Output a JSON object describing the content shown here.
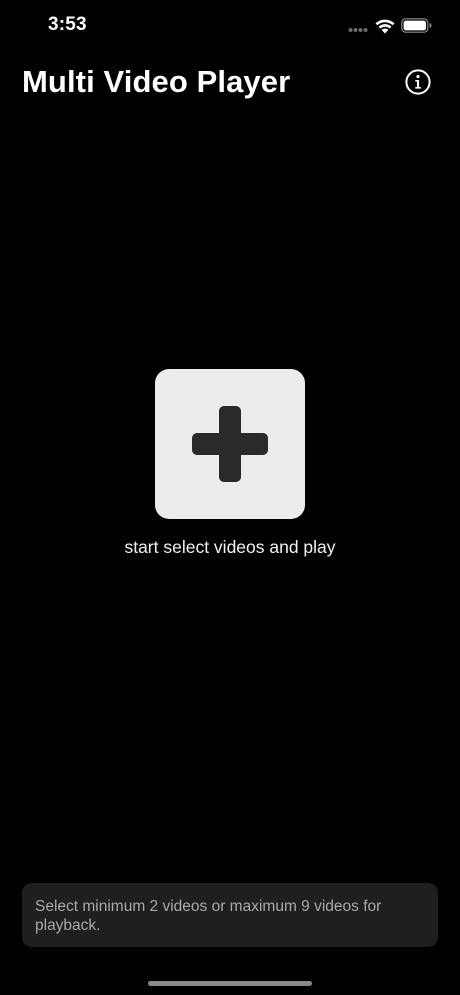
{
  "status_bar": {
    "time": "3:53",
    "icons": [
      "signal-dots-icon",
      "wifi-icon",
      "battery-icon"
    ]
  },
  "nav": {
    "title": "Multi Video Player",
    "info_icon": "info-circle-icon"
  },
  "main": {
    "add_icon": "plus-icon",
    "caption": "start select videos and play"
  },
  "hint": {
    "text": "Select minimum 2 videos or maximum 9 videos for playback."
  },
  "colors": {
    "background": "#000000",
    "add_tile": "#ececec",
    "plus": "#2a2a2a",
    "hint_bg": "#1f1f21",
    "hint_text": "#a8a8ad"
  }
}
